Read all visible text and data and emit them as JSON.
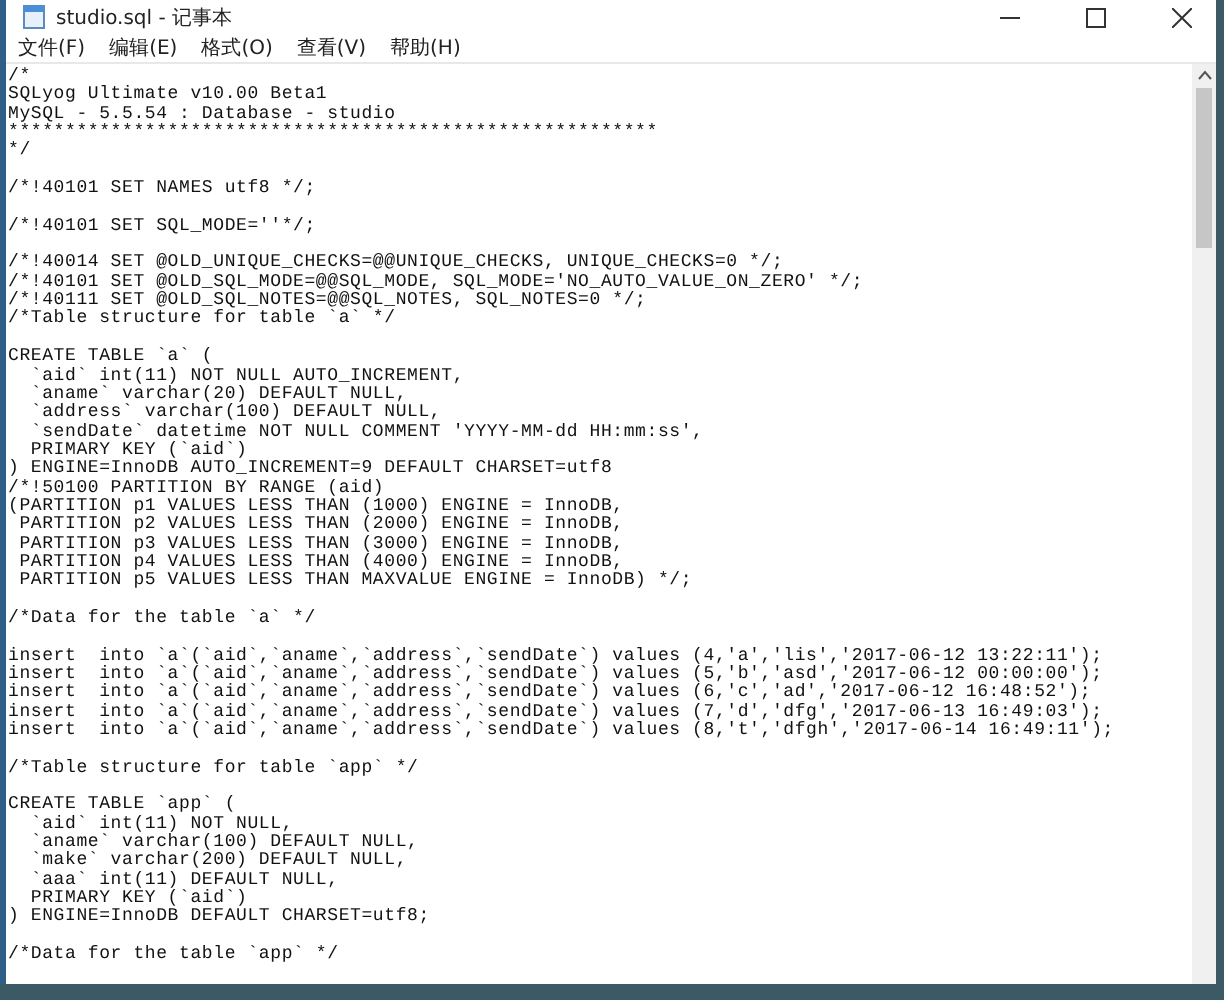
{
  "window": {
    "title": "studio.sql - 记事本"
  },
  "menu": [
    "文件(F)",
    "编辑(E)",
    "格式(O)",
    "查看(V)",
    "帮助(H)"
  ],
  "document": {
    "blocks": [
      {
        "lines": [
          "/*",
          "SQLyog Ultimate v10.00 Beta1",
          "MySQL - 5.5.54 : Database - studio",
          "*********************************************************",
          "*/"
        ]
      },
      {
        "lines": [
          "/*!40101 SET NAMES utf8 */;"
        ]
      },
      {
        "lines": [
          "/*!40101 SET SQL_MODE=''*/;"
        ]
      },
      {
        "lines": [
          "/*!40014 SET @OLD_UNIQUE_CHECKS=@@UNIQUE_CHECKS, UNIQUE_CHECKS=0 */;",
          "/*!40101 SET @OLD_SQL_MODE=@@SQL_MODE, SQL_MODE='NO_AUTO_VALUE_ON_ZERO' */;",
          "/*!40111 SET @OLD_SQL_NOTES=@@SQL_NOTES, SQL_NOTES=0 */;",
          "/*Table structure for table `a` */"
        ]
      },
      {
        "lines": [
          "CREATE TABLE `a` (",
          "  `aid` int(11) NOT NULL AUTO_INCREMENT,",
          "  `aname` varchar(20) DEFAULT NULL,",
          "  `address` varchar(100) DEFAULT NULL,",
          "  `sendDate` datetime NOT NULL COMMENT 'YYYY-MM-dd HH:mm:ss',",
          "  PRIMARY KEY (`aid`)",
          ") ENGINE=InnoDB AUTO_INCREMENT=9 DEFAULT CHARSET=utf8",
          "/*!50100 PARTITION BY RANGE (aid)",
          "(PARTITION p1 VALUES LESS THAN (1000) ENGINE = InnoDB,",
          " PARTITION p2 VALUES LESS THAN (2000) ENGINE = InnoDB,",
          " PARTITION p3 VALUES LESS THAN (3000) ENGINE = InnoDB,",
          " PARTITION p4 VALUES LESS THAN (4000) ENGINE = InnoDB,",
          " PARTITION p5 VALUES LESS THAN MAXVALUE ENGINE = InnoDB) */;"
        ]
      },
      {
        "lines": [
          "/*Data for the table `a` */"
        ]
      },
      {
        "lines": [
          "insert  into `a`(`aid`,`aname`,`address`,`sendDate`) values (4,'a','lis','2017-06-12 13:22:11');",
          "insert  into `a`(`aid`,`aname`,`address`,`sendDate`) values (5,'b','asd','2017-06-12 00:00:00');",
          "insert  into `a`(`aid`,`aname`,`address`,`sendDate`) values (6,'c','ad','2017-06-12 16:48:52');",
          "insert  into `a`(`aid`,`aname`,`address`,`sendDate`) values (7,'d','dfg','2017-06-13 16:49:03');",
          "insert  into `a`(`aid`,`aname`,`address`,`sendDate`) values (8,'t','dfgh','2017-06-14 16:49:11');"
        ]
      },
      {
        "lines": [
          "/*Table structure for table `app` */"
        ]
      },
      {
        "lines": [
          "CREATE TABLE `app` (",
          "  `aid` int(11) NOT NULL,",
          "  `aname` varchar(100) DEFAULT NULL,",
          "  `make` varchar(200) DEFAULT NULL,",
          "  `aaa` int(11) DEFAULT NULL,",
          "  PRIMARY KEY (`aid`)",
          ") ENGINE=InnoDB DEFAULT CHARSET=utf8;"
        ]
      },
      {
        "lines": [
          "/*Data for the table `app` */"
        ]
      }
    ]
  }
}
